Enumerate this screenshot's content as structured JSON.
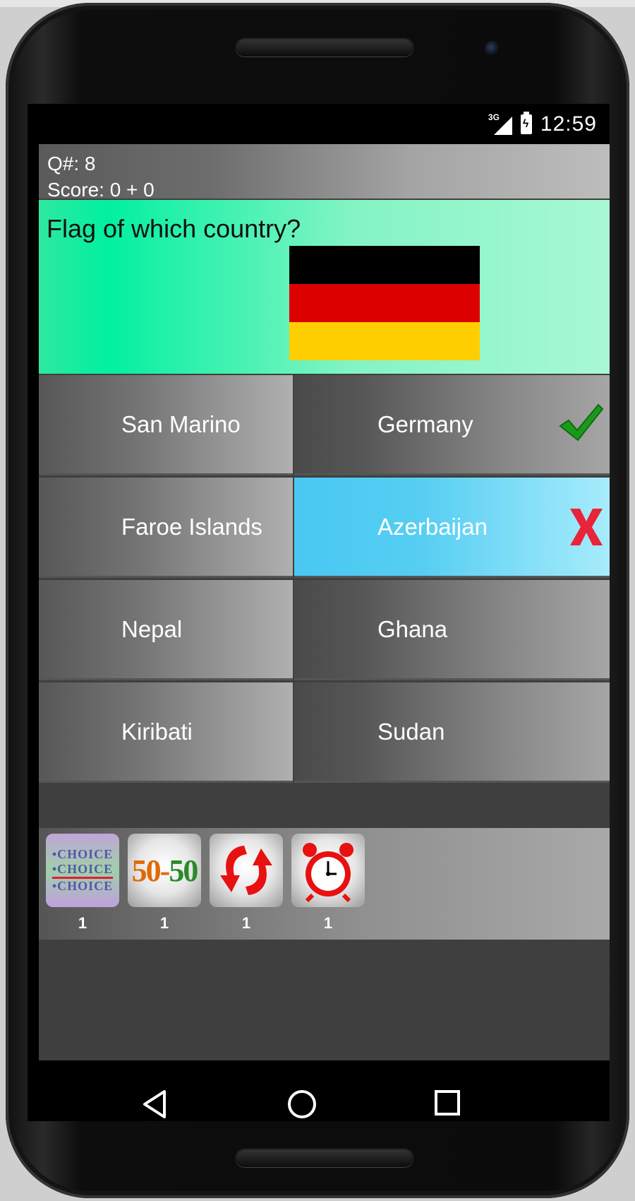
{
  "status_bar": {
    "network": "3G",
    "time": "12:59"
  },
  "header": {
    "question_number": "Q#: 8",
    "score": "Score: 0 + 0"
  },
  "question": {
    "prompt": "Flag of which country?",
    "flag_colors": [
      "#000000",
      "#dd0000",
      "#ffce00"
    ]
  },
  "answers": [
    {
      "label": "San Marino",
      "state": "none"
    },
    {
      "label": "Germany",
      "state": "correct",
      "icon": "checkmark-icon"
    },
    {
      "label": "Faroe Islands",
      "state": "none"
    },
    {
      "label": "Azerbaijan",
      "state": "wrong-selected",
      "icon": "x-mark-icon"
    },
    {
      "label": "Nepal",
      "state": "none"
    },
    {
      "label": "Ghana",
      "state": "none"
    },
    {
      "label": "Kiribati",
      "state": "none"
    },
    {
      "label": "Sudan",
      "state": "none"
    }
  ],
  "powerups": [
    {
      "name": "choice",
      "icon": "choice-icon",
      "lines": [
        "•CHOICE",
        "•CHOICE",
        "•CHOICE"
      ],
      "count": "1"
    },
    {
      "name": "fifty-fifty",
      "icon": "fifty-fifty-icon",
      "text": "50-50",
      "count": "1"
    },
    {
      "name": "skip",
      "icon": "skip-arrows-icon",
      "count": "1"
    },
    {
      "name": "time",
      "icon": "alarm-clock-icon",
      "count": "1"
    }
  ],
  "colors": {
    "accent_question": "#02f0a0",
    "selected": "#56cef2",
    "correct": "#1a9a1a",
    "wrong": "#e8233a"
  },
  "navigation": [
    "back-icon",
    "home-icon",
    "recents-icon"
  ]
}
